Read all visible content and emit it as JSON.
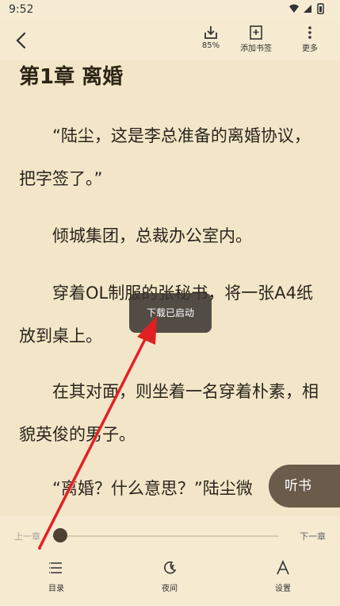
{
  "status": {
    "time": "9:52",
    "icons": "▾◢▮"
  },
  "toolbar": {
    "download_label": "85%",
    "bookmark_label": "添加书签",
    "more_label": "更多"
  },
  "chapter": {
    "title": "第1章  离婚"
  },
  "paragraphs": [
    "“陆尘，这是李总准备的离婚协议，把字签了。”",
    "倾城集团，总裁办公室内。",
    "穿着OL制服的张秘书，将一张A4纸放到桌上。",
    "在其对面，则坐着一名穿着朴素，相貌英俊的男子。",
    "“离婚？什么意思？”陆尘微"
  ],
  "listen_label": "听书",
  "toast": "下载已启动",
  "progress": {
    "prev": "上一章",
    "next": "下一章",
    "value": 0.0
  },
  "bottom_nav": {
    "toc": "目录",
    "night": "夜间",
    "settings": "设置"
  },
  "colors": {
    "page_bg": "#f3e6c8",
    "accent": "#6b5b4b",
    "annotation_arrow": "#e02020"
  }
}
